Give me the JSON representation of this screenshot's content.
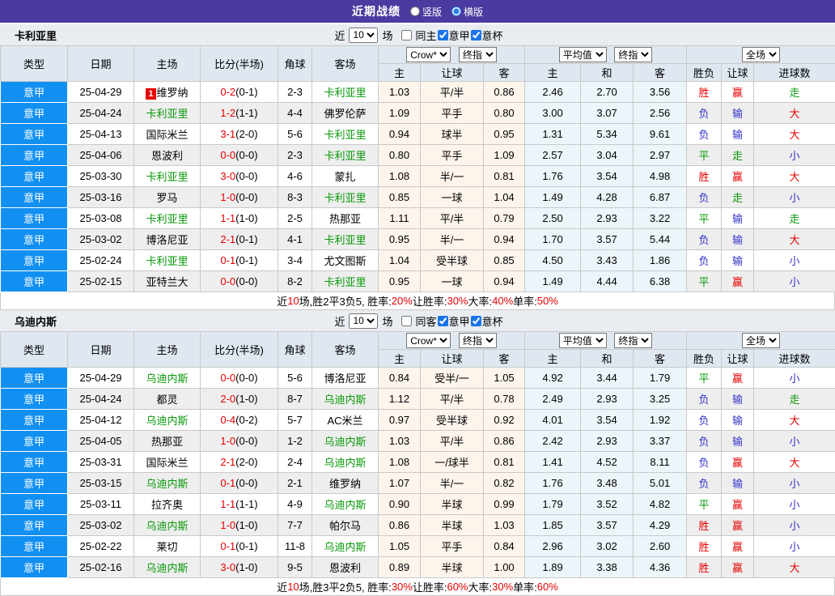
{
  "topbar": {
    "title": "近期战绩",
    "radios": [
      {
        "label": "竖版",
        "selected": false
      },
      {
        "label": "横版",
        "selected": true
      }
    ]
  },
  "colors": {
    "purple": "#4b3aa0",
    "accent": "#1290f2",
    "section_bg": "#e9edf2",
    "header_bg": "#dfe8f1",
    "stripe": "#eeeeee",
    "crow_bg": "#fdf4ec",
    "avg_bg": "#ebf5fa",
    "red": "#e60000",
    "green": "#089908",
    "blue": "#3333cc"
  },
  "table_header": {
    "cols": [
      "类型",
      "日期",
      "主场",
      "比分(半场)",
      "角球",
      "客场"
    ],
    "sub": [
      "主",
      "让球",
      "客",
      "主",
      "和",
      "客",
      "胜负",
      "让球",
      "进球数"
    ],
    "group_selects": {
      "g1": [
        "Crow*",
        "终指"
      ],
      "g2": [
        "平均值",
        "终指"
      ],
      "g3": [
        "全场"
      ]
    }
  },
  "sections": [
    {
      "team": "卡利亚里",
      "controls": {
        "prefix": "近",
        "count": "10",
        "suffix": "场",
        "checkboxes": [
          {
            "label": "同主",
            "checked": false
          },
          {
            "label": "意甲",
            "checked": true
          },
          {
            "label": "意杯",
            "checked": true
          }
        ]
      },
      "rows": [
        {
          "type": "意甲",
          "date": "25-04-29",
          "home": "维罗纳",
          "home_hl": false,
          "badge": "1",
          "ft": "0-2",
          "ht": "0-1",
          "corner": "2-3",
          "away": "卡利亚里",
          "away_hl": true,
          "o1": [
            "1.03",
            "平/半",
            "0.86"
          ],
          "o2": [
            "2.46",
            "2.70",
            "3.56"
          ],
          "res": [
            [
              "胜",
              "r"
            ],
            [
              "赢",
              "r"
            ],
            [
              "走",
              "g"
            ]
          ]
        },
        {
          "type": "意甲",
          "date": "25-04-24",
          "home": "卡利亚里",
          "home_hl": true,
          "badge": null,
          "ft": "1-2",
          "ht": "1-1",
          "corner": "4-4",
          "away": "佛罗伦萨",
          "away_hl": false,
          "o1": [
            "1.09",
            "平手",
            "0.80"
          ],
          "o2": [
            "3.00",
            "3.07",
            "2.56"
          ],
          "res": [
            [
              "负",
              "b"
            ],
            [
              "输",
              "b"
            ],
            [
              "大",
              "r"
            ]
          ]
        },
        {
          "type": "意甲",
          "date": "25-04-13",
          "home": "国际米兰",
          "home_hl": false,
          "badge": null,
          "ft": "3-1",
          "ht": "2-0",
          "corner": "5-6",
          "away": "卡利亚里",
          "away_hl": true,
          "o1": [
            "0.94",
            "球半",
            "0.95"
          ],
          "o2": [
            "1.31",
            "5.34",
            "9.61"
          ],
          "res": [
            [
              "负",
              "b"
            ],
            [
              "输",
              "b"
            ],
            [
              "大",
              "r"
            ]
          ]
        },
        {
          "type": "意甲",
          "date": "25-04-06",
          "home": "恩波利",
          "home_hl": false,
          "badge": null,
          "ft": "0-0",
          "ht": "0-0",
          "corner": "2-3",
          "away": "卡利亚里",
          "away_hl": true,
          "o1": [
            "0.80",
            "平手",
            "1.09"
          ],
          "o2": [
            "2.57",
            "3.04",
            "2.97"
          ],
          "res": [
            [
              "平",
              "g"
            ],
            [
              "走",
              "g"
            ],
            [
              "小",
              "b"
            ]
          ]
        },
        {
          "type": "意甲",
          "date": "25-03-30",
          "home": "卡利亚里",
          "home_hl": true,
          "badge": null,
          "ft": "3-0",
          "ht": "0-0",
          "corner": "4-6",
          "away": "蒙扎",
          "away_hl": false,
          "o1": [
            "1.08",
            "半/一",
            "0.81"
          ],
          "o2": [
            "1.76",
            "3.54",
            "4.98"
          ],
          "res": [
            [
              "胜",
              "r"
            ],
            [
              "赢",
              "r"
            ],
            [
              "大",
              "r"
            ]
          ]
        },
        {
          "type": "意甲",
          "date": "25-03-16",
          "home": "罗马",
          "home_hl": false,
          "badge": null,
          "ft": "1-0",
          "ht": "0-0",
          "corner": "8-3",
          "away": "卡利亚里",
          "away_hl": true,
          "o1": [
            "0.85",
            "一球",
            "1.04"
          ],
          "o2": [
            "1.49",
            "4.28",
            "6.87"
          ],
          "res": [
            [
              "负",
              "b"
            ],
            [
              "走",
              "g"
            ],
            [
              "小",
              "b"
            ]
          ]
        },
        {
          "type": "意甲",
          "date": "25-03-08",
          "home": "卡利亚里",
          "home_hl": true,
          "badge": null,
          "ft": "1-1",
          "ht": "1-0",
          "corner": "2-5",
          "away": "热那亚",
          "away_hl": false,
          "o1": [
            "1.11",
            "平/半",
            "0.79"
          ],
          "o2": [
            "2.50",
            "2.93",
            "3.22"
          ],
          "res": [
            [
              "平",
              "g"
            ],
            [
              "输",
              "b"
            ],
            [
              "走",
              "g"
            ]
          ]
        },
        {
          "type": "意甲",
          "date": "25-03-02",
          "home": "博洛尼亚",
          "home_hl": false,
          "badge": null,
          "ft": "2-1",
          "ht": "0-1",
          "corner": "4-1",
          "away": "卡利亚里",
          "away_hl": true,
          "o1": [
            "0.95",
            "半/一",
            "0.94"
          ],
          "o2": [
            "1.70",
            "3.57",
            "5.44"
          ],
          "res": [
            [
              "负",
              "b"
            ],
            [
              "输",
              "b"
            ],
            [
              "大",
              "r"
            ]
          ]
        },
        {
          "type": "意甲",
          "date": "25-02-24",
          "home": "卡利亚里",
          "home_hl": true,
          "badge": null,
          "ft": "0-1",
          "ht": "0-1",
          "corner": "3-4",
          "away": "尤文图斯",
          "away_hl": false,
          "o1": [
            "1.04",
            "受半球",
            "0.85"
          ],
          "o2": [
            "4.50",
            "3.43",
            "1.86"
          ],
          "res": [
            [
              "负",
              "b"
            ],
            [
              "输",
              "b"
            ],
            [
              "小",
              "b"
            ]
          ]
        },
        {
          "type": "意甲",
          "date": "25-02-15",
          "home": "亚特兰大",
          "home_hl": false,
          "badge": null,
          "ft": "0-0",
          "ht": "0-0",
          "corner": "8-2",
          "away": "卡利亚里",
          "away_hl": true,
          "o1": [
            "0.95",
            "一球",
            "0.94"
          ],
          "o2": [
            "1.49",
            "4.44",
            "6.38"
          ],
          "res": [
            [
              "平",
              "g"
            ],
            [
              "赢",
              "r"
            ],
            [
              "小",
              "b"
            ]
          ]
        }
      ],
      "summary": [
        [
          "近",
          "k"
        ],
        [
          "10",
          "r"
        ],
        [
          "场,胜2平3负5, 胜率:",
          "k"
        ],
        [
          "20%",
          "r"
        ],
        [
          " 让胜率:",
          "k"
        ],
        [
          "30%",
          "r"
        ],
        [
          " 大率:",
          "k"
        ],
        [
          "40%",
          "r"
        ],
        [
          " 单率:",
          "k"
        ],
        [
          "50%",
          "r"
        ]
      ]
    },
    {
      "team": "乌迪内斯",
      "controls": {
        "prefix": "近",
        "count": "10",
        "suffix": "场",
        "checkboxes": [
          {
            "label": "同客",
            "checked": false
          },
          {
            "label": "意甲",
            "checked": true
          },
          {
            "label": "意杯",
            "checked": true
          }
        ]
      },
      "rows": [
        {
          "type": "意甲",
          "date": "25-04-29",
          "home": "乌迪内斯",
          "home_hl": true,
          "badge": null,
          "ft": "0-0",
          "ht": "0-0",
          "corner": "5-6",
          "away": "博洛尼亚",
          "away_hl": false,
          "o1": [
            "0.84",
            "受半/一",
            "1.05"
          ],
          "o2": [
            "4.92",
            "3.44",
            "1.79"
          ],
          "res": [
            [
              "平",
              "g"
            ],
            [
              "赢",
              "r"
            ],
            [
              "小",
              "b"
            ]
          ]
        },
        {
          "type": "意甲",
          "date": "25-04-24",
          "home": "都灵",
          "home_hl": false,
          "badge": null,
          "ft": "2-0",
          "ht": "1-0",
          "corner": "8-7",
          "away": "乌迪内斯",
          "away_hl": true,
          "o1": [
            "1.12",
            "平/半",
            "0.78"
          ],
          "o2": [
            "2.49",
            "2.93",
            "3.25"
          ],
          "res": [
            [
              "负",
              "b"
            ],
            [
              "输",
              "b"
            ],
            [
              "走",
              "g"
            ]
          ]
        },
        {
          "type": "意甲",
          "date": "25-04-12",
          "home": "乌迪内斯",
          "home_hl": true,
          "badge": null,
          "ft": "0-4",
          "ht": "0-2",
          "corner": "5-7",
          "away": "AC米兰",
          "away_hl": false,
          "o1": [
            "0.97",
            "受半球",
            "0.92"
          ],
          "o2": [
            "4.01",
            "3.54",
            "1.92"
          ],
          "res": [
            [
              "负",
              "b"
            ],
            [
              "输",
              "b"
            ],
            [
              "大",
              "r"
            ]
          ]
        },
        {
          "type": "意甲",
          "date": "25-04-05",
          "home": "热那亚",
          "home_hl": false,
          "badge": null,
          "ft": "1-0",
          "ht": "0-0",
          "corner": "1-2",
          "away": "乌迪内斯",
          "away_hl": true,
          "o1": [
            "1.03",
            "平/半",
            "0.86"
          ],
          "o2": [
            "2.42",
            "2.93",
            "3.37"
          ],
          "res": [
            [
              "负",
              "b"
            ],
            [
              "输",
              "b"
            ],
            [
              "小",
              "b"
            ]
          ]
        },
        {
          "type": "意甲",
          "date": "25-03-31",
          "home": "国际米兰",
          "home_hl": false,
          "badge": null,
          "ft": "2-1",
          "ht": "2-0",
          "corner": "2-4",
          "away": "乌迪内斯",
          "away_hl": true,
          "o1": [
            "1.08",
            "一/球半",
            "0.81"
          ],
          "o2": [
            "1.41",
            "4.52",
            "8.11"
          ],
          "res": [
            [
              "负",
              "b"
            ],
            [
              "赢",
              "r"
            ],
            [
              "大",
              "r"
            ]
          ]
        },
        {
          "type": "意甲",
          "date": "25-03-15",
          "home": "乌迪内斯",
          "home_hl": true,
          "badge": null,
          "ft": "0-1",
          "ht": "0-0",
          "corner": "2-1",
          "away": "维罗纳",
          "away_hl": false,
          "o1": [
            "1.07",
            "半/一",
            "0.82"
          ],
          "o2": [
            "1.76",
            "3.48",
            "5.01"
          ],
          "res": [
            [
              "负",
              "b"
            ],
            [
              "输",
              "b"
            ],
            [
              "小",
              "b"
            ]
          ]
        },
        {
          "type": "意甲",
          "date": "25-03-11",
          "home": "拉齐奥",
          "home_hl": false,
          "badge": null,
          "ft": "1-1",
          "ht": "1-1",
          "corner": "4-9",
          "away": "乌迪内斯",
          "away_hl": true,
          "o1": [
            "0.90",
            "半球",
            "0.99"
          ],
          "o2": [
            "1.79",
            "3.52",
            "4.82"
          ],
          "res": [
            [
              "平",
              "g"
            ],
            [
              "赢",
              "r"
            ],
            [
              "小",
              "b"
            ]
          ]
        },
        {
          "type": "意甲",
          "date": "25-03-02",
          "home": "乌迪内斯",
          "home_hl": true,
          "badge": null,
          "ft": "1-0",
          "ht": "1-0",
          "corner": "7-7",
          "away": "帕尔马",
          "away_hl": false,
          "o1": [
            "0.86",
            "半球",
            "1.03"
          ],
          "o2": [
            "1.85",
            "3.57",
            "4.29"
          ],
          "res": [
            [
              "胜",
              "r"
            ],
            [
              "赢",
              "r"
            ],
            [
              "小",
              "b"
            ]
          ]
        },
        {
          "type": "意甲",
          "date": "25-02-22",
          "home": "莱切",
          "home_hl": false,
          "badge": null,
          "ft": "0-1",
          "ht": "0-1",
          "corner": "11-8",
          "away": "乌迪内斯",
          "away_hl": true,
          "o1": [
            "1.05",
            "平手",
            "0.84"
          ],
          "o2": [
            "2.96",
            "3.02",
            "2.60"
          ],
          "res": [
            [
              "胜",
              "r"
            ],
            [
              "赢",
              "r"
            ],
            [
              "小",
              "b"
            ]
          ]
        },
        {
          "type": "意甲",
          "date": "25-02-16",
          "home": "乌迪内斯",
          "home_hl": true,
          "badge": null,
          "ft": "3-0",
          "ht": "1-0",
          "corner": "9-5",
          "away": "恩波利",
          "away_hl": false,
          "o1": [
            "0.89",
            "半球",
            "1.00"
          ],
          "o2": [
            "1.89",
            "3.38",
            "4.36"
          ],
          "res": [
            [
              "胜",
              "r"
            ],
            [
              "赢",
              "r"
            ],
            [
              "大",
              "r"
            ]
          ]
        }
      ],
      "summary": [
        [
          "近",
          "k"
        ],
        [
          "10",
          "r"
        ],
        [
          "场,胜3平2负5, 胜率:",
          "k"
        ],
        [
          "30%",
          "r"
        ],
        [
          " 让胜率:",
          "k"
        ],
        [
          "60%",
          "r"
        ],
        [
          " 大率:",
          "k"
        ],
        [
          "30%",
          "r"
        ],
        [
          " 单率:",
          "k"
        ],
        [
          "60%",
          "r"
        ]
      ]
    }
  ]
}
